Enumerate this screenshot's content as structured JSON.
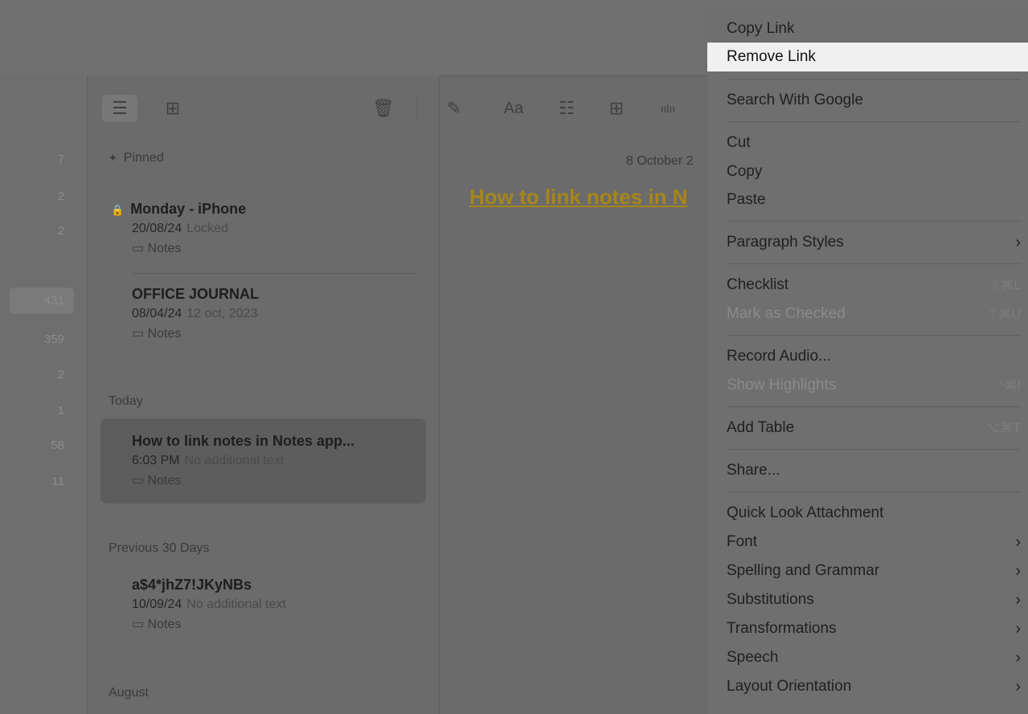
{
  "sidebar": {
    "counts": [
      "7",
      "2",
      "2",
      "431",
      "359",
      "2",
      "1",
      "58",
      "11"
    ]
  },
  "toolbar": {
    "list_icon": "☰",
    "grid_icon": "⊞",
    "trash_icon": "🗑",
    "compose_icon": "✎",
    "format_label": "Aa",
    "checklist_icon": "☷",
    "table_icon": "⊞",
    "audio_icon": "ıılıı"
  },
  "list": {
    "pinned_header": "Pinned",
    "today_header": "Today",
    "prev30_header": "Previous 30 Days",
    "august_header": "August",
    "notes": [
      {
        "title": "Monday - iPhone",
        "date": "20/08/24",
        "sub": "Locked",
        "folder": "Notes"
      },
      {
        "title": "OFFICE JOURNAL",
        "date": "08/04/24",
        "sub": "12 oct, 2023",
        "folder": "Notes"
      },
      {
        "title": "How to link notes in Notes app...",
        "date": "6:03 PM",
        "sub": "No additional text",
        "folder": "Notes"
      },
      {
        "title": "a$4*jhZ7!JKyNBs",
        "date": "10/09/24",
        "sub": "No additional text",
        "folder": "Notes"
      }
    ]
  },
  "editor": {
    "date": "8 October 2",
    "title": "How to link notes in N"
  },
  "menu": {
    "items": [
      {
        "label": "Copy Link"
      },
      {
        "label": "Remove Link"
      },
      {
        "label": "Search With Google"
      },
      {
        "label": "Cut"
      },
      {
        "label": "Copy"
      },
      {
        "label": "Paste"
      },
      {
        "label": "Paragraph Styles",
        "arrow": "›"
      },
      {
        "label": "Checklist",
        "shortcut": "⇧⌘L"
      },
      {
        "label": "Mark as Checked",
        "shortcut": "⇧⌘U"
      },
      {
        "label": "Record Audio..."
      },
      {
        "label": "Show Highlights",
        "shortcut": "^⌘I"
      },
      {
        "label": "Add Table",
        "shortcut": "⌥⌘T"
      },
      {
        "label": "Share..."
      },
      {
        "label": "Quick Look Attachment"
      },
      {
        "label": "Font",
        "arrow": "›"
      },
      {
        "label": "Spelling and Grammar",
        "arrow": "›"
      },
      {
        "label": "Substitutions",
        "arrow": "›"
      },
      {
        "label": "Transformations",
        "arrow": "›"
      },
      {
        "label": "Speech",
        "arrow": "›"
      },
      {
        "label": "Layout Orientation",
        "arrow": "›"
      }
    ]
  }
}
